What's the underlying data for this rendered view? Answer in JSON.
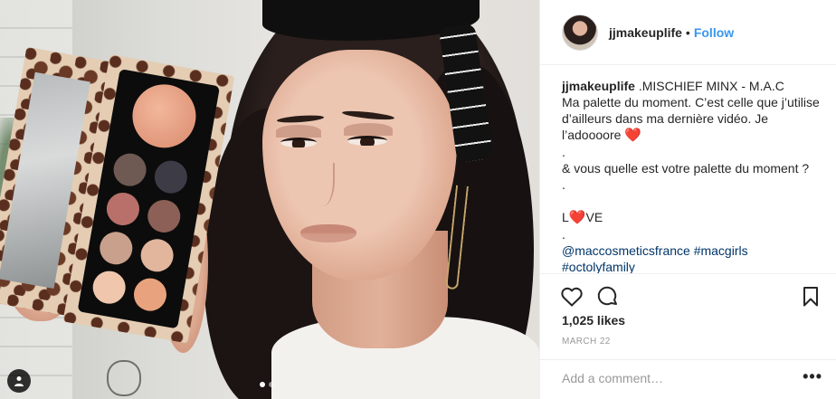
{
  "post": {
    "username": "jjmakeuplife",
    "separator": "•",
    "follow_label": "Follow",
    "caption_lines": [
      ".MISCHIEF MINX - M.A.C",
      "Ma palette du moment. C’est celle que j’utilise d’ailleurs dans ma dernière vidéo. Je l’adoooore",
      ".",
      "& vous quelle est votre palette du moment ?",
      ".",
      "",
      "L",
      "VE",
      "."
    ],
    "hashtags_line1": "@maccosmeticsfrance #macgirls",
    "hashtags_line2": "#octolyfamily",
    "heart_emoji": "❤️",
    "likes": "1,025 likes",
    "date": "MARCH 22",
    "comment_placeholder": "Add a comment…",
    "more_label": "•••",
    "carousel": {
      "count": 2,
      "active": 1
    }
  },
  "icons": {
    "like": "heart-outline-icon",
    "comment": "comment-bubble-icon",
    "save": "bookmark-icon",
    "tag": "user-tag-icon"
  },
  "colors": {
    "link": "#3897f0",
    "hashtag": "#003569",
    "heart": "#e0302f",
    "muted": "#999999",
    "text": "#262626"
  }
}
